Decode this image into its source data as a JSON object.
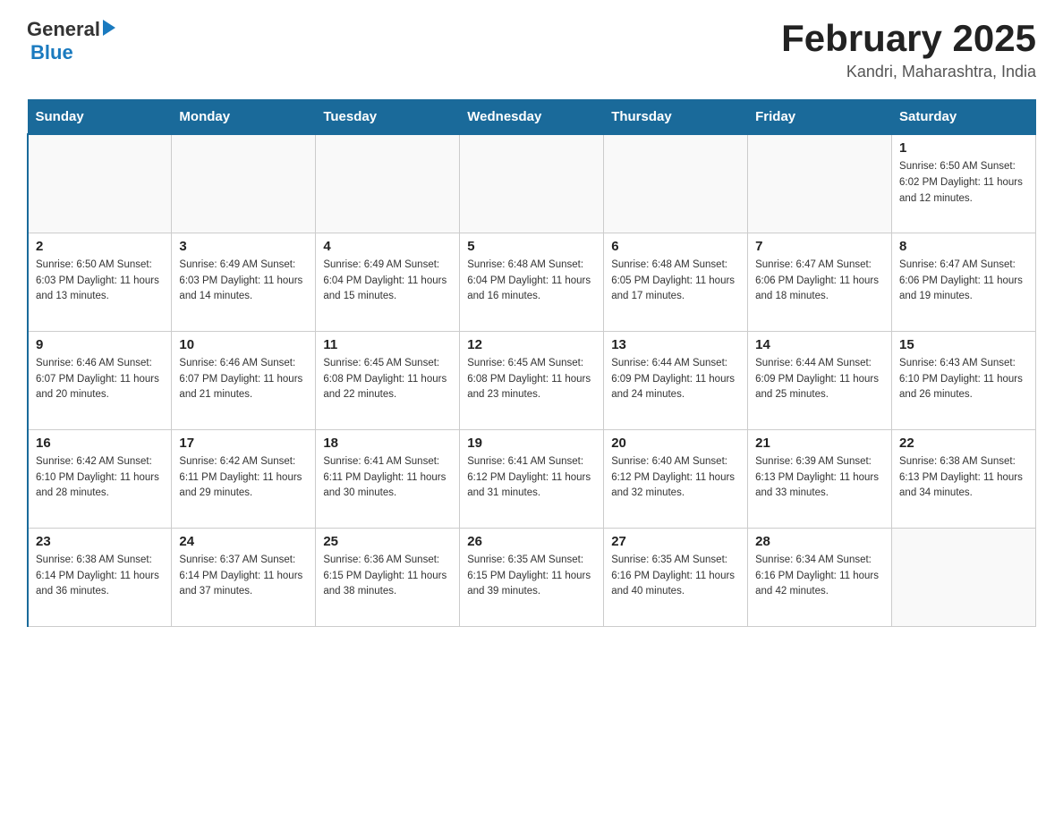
{
  "header": {
    "logo_general": "General",
    "logo_blue": "Blue",
    "title": "February 2025",
    "subtitle": "Kandri, Maharashtra, India"
  },
  "weekdays": [
    "Sunday",
    "Monday",
    "Tuesday",
    "Wednesday",
    "Thursday",
    "Friday",
    "Saturday"
  ],
  "weeks": [
    [
      {
        "day": "",
        "info": ""
      },
      {
        "day": "",
        "info": ""
      },
      {
        "day": "",
        "info": ""
      },
      {
        "day": "",
        "info": ""
      },
      {
        "day": "",
        "info": ""
      },
      {
        "day": "",
        "info": ""
      },
      {
        "day": "1",
        "info": "Sunrise: 6:50 AM\nSunset: 6:02 PM\nDaylight: 11 hours\nand 12 minutes."
      }
    ],
    [
      {
        "day": "2",
        "info": "Sunrise: 6:50 AM\nSunset: 6:03 PM\nDaylight: 11 hours\nand 13 minutes."
      },
      {
        "day": "3",
        "info": "Sunrise: 6:49 AM\nSunset: 6:03 PM\nDaylight: 11 hours\nand 14 minutes."
      },
      {
        "day": "4",
        "info": "Sunrise: 6:49 AM\nSunset: 6:04 PM\nDaylight: 11 hours\nand 15 minutes."
      },
      {
        "day": "5",
        "info": "Sunrise: 6:48 AM\nSunset: 6:04 PM\nDaylight: 11 hours\nand 16 minutes."
      },
      {
        "day": "6",
        "info": "Sunrise: 6:48 AM\nSunset: 6:05 PM\nDaylight: 11 hours\nand 17 minutes."
      },
      {
        "day": "7",
        "info": "Sunrise: 6:47 AM\nSunset: 6:06 PM\nDaylight: 11 hours\nand 18 minutes."
      },
      {
        "day": "8",
        "info": "Sunrise: 6:47 AM\nSunset: 6:06 PM\nDaylight: 11 hours\nand 19 minutes."
      }
    ],
    [
      {
        "day": "9",
        "info": "Sunrise: 6:46 AM\nSunset: 6:07 PM\nDaylight: 11 hours\nand 20 minutes."
      },
      {
        "day": "10",
        "info": "Sunrise: 6:46 AM\nSunset: 6:07 PM\nDaylight: 11 hours\nand 21 minutes."
      },
      {
        "day": "11",
        "info": "Sunrise: 6:45 AM\nSunset: 6:08 PM\nDaylight: 11 hours\nand 22 minutes."
      },
      {
        "day": "12",
        "info": "Sunrise: 6:45 AM\nSunset: 6:08 PM\nDaylight: 11 hours\nand 23 minutes."
      },
      {
        "day": "13",
        "info": "Sunrise: 6:44 AM\nSunset: 6:09 PM\nDaylight: 11 hours\nand 24 minutes."
      },
      {
        "day": "14",
        "info": "Sunrise: 6:44 AM\nSunset: 6:09 PM\nDaylight: 11 hours\nand 25 minutes."
      },
      {
        "day": "15",
        "info": "Sunrise: 6:43 AM\nSunset: 6:10 PM\nDaylight: 11 hours\nand 26 minutes."
      }
    ],
    [
      {
        "day": "16",
        "info": "Sunrise: 6:42 AM\nSunset: 6:10 PM\nDaylight: 11 hours\nand 28 minutes."
      },
      {
        "day": "17",
        "info": "Sunrise: 6:42 AM\nSunset: 6:11 PM\nDaylight: 11 hours\nand 29 minutes."
      },
      {
        "day": "18",
        "info": "Sunrise: 6:41 AM\nSunset: 6:11 PM\nDaylight: 11 hours\nand 30 minutes."
      },
      {
        "day": "19",
        "info": "Sunrise: 6:41 AM\nSunset: 6:12 PM\nDaylight: 11 hours\nand 31 minutes."
      },
      {
        "day": "20",
        "info": "Sunrise: 6:40 AM\nSunset: 6:12 PM\nDaylight: 11 hours\nand 32 minutes."
      },
      {
        "day": "21",
        "info": "Sunrise: 6:39 AM\nSunset: 6:13 PM\nDaylight: 11 hours\nand 33 minutes."
      },
      {
        "day": "22",
        "info": "Sunrise: 6:38 AM\nSunset: 6:13 PM\nDaylight: 11 hours\nand 34 minutes."
      }
    ],
    [
      {
        "day": "23",
        "info": "Sunrise: 6:38 AM\nSunset: 6:14 PM\nDaylight: 11 hours\nand 36 minutes."
      },
      {
        "day": "24",
        "info": "Sunrise: 6:37 AM\nSunset: 6:14 PM\nDaylight: 11 hours\nand 37 minutes."
      },
      {
        "day": "25",
        "info": "Sunrise: 6:36 AM\nSunset: 6:15 PM\nDaylight: 11 hours\nand 38 minutes."
      },
      {
        "day": "26",
        "info": "Sunrise: 6:35 AM\nSunset: 6:15 PM\nDaylight: 11 hours\nand 39 minutes."
      },
      {
        "day": "27",
        "info": "Sunrise: 6:35 AM\nSunset: 6:16 PM\nDaylight: 11 hours\nand 40 minutes."
      },
      {
        "day": "28",
        "info": "Sunrise: 6:34 AM\nSunset: 6:16 PM\nDaylight: 11 hours\nand 42 minutes."
      },
      {
        "day": "",
        "info": ""
      }
    ]
  ]
}
